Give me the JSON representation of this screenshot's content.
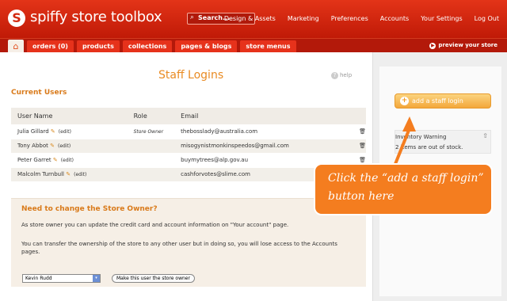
{
  "brand": {
    "name": "spiffy store toolbox",
    "logo_letter": "S"
  },
  "search": {
    "placeholder": "Search..."
  },
  "top_nav": [
    "Design & Assets",
    "Marketing",
    "Preferences",
    "Accounts",
    "Your Settings",
    "Log Out"
  ],
  "tabs": [
    "orders (0)",
    "products",
    "collections",
    "pages & blogs",
    "store menus"
  ],
  "preview_label": "preview your store",
  "page": {
    "title": "Staff Logins",
    "help": "help",
    "section_title": "Current Users"
  },
  "users_table": {
    "headers": [
      "User Name",
      "Role",
      "Email"
    ],
    "edit_label": "(edit)",
    "rows": [
      {
        "name": "Julia Gillard",
        "role": "Store Owner",
        "email": "thebosslady@australia.com"
      },
      {
        "name": "Tony Abbot",
        "role": "",
        "email": "misogynistmonkinspeedos@gmail.com"
      },
      {
        "name": "Peter Garret",
        "role": "",
        "email": "buymytrees@alp.gov.au"
      },
      {
        "name": "Malcolm Turnbull",
        "role": "",
        "email": "cashforvotes@slime.com"
      }
    ]
  },
  "owner": {
    "title": "Need to change the Store Owner?",
    "p1": "As store owner you can update the credit card and account information on \"Your account\" page.",
    "p2": "You can transfer the ownership of the store to any other user but in doing so, you will lose access to the Accounts pages.",
    "select_value": "Kevin Rudd",
    "button": "Make this user the store owner"
  },
  "sidebar": {
    "add_button": "add a staff login",
    "inventory_title": "Inventory Warning",
    "inventory_text": "2 items are out of stock."
  },
  "annotation": {
    "text": "Click the “add a staff login” button here",
    "color": "#f47d1f"
  },
  "colors": {
    "header": "#d32a10",
    "accent": "#e98b23",
    "button": "#f3a73b"
  }
}
